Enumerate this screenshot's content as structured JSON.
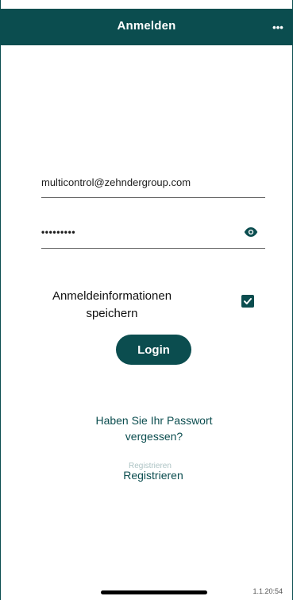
{
  "app": {
    "title": "Anmelden",
    "more_icon": "more-icon"
  },
  "form": {
    "email_value": "multicontrol@zehndergroup.com",
    "password_value": "•••••••••",
    "remember_label": "Anmeldeinformationen\nspeichern",
    "remember_checked": true
  },
  "actions": {
    "login_label": "Login",
    "forgot_password_label": "Haben Sie Ihr Passwort vergessen?",
    "register_ghost_label": "Registrieren",
    "register_label": "Registrieren"
  },
  "footer": {
    "version": "1.1.20:54"
  },
  "colors": {
    "primary": "#0b4d4f",
    "text": "#1a1a1a",
    "background": "#ffffff"
  }
}
